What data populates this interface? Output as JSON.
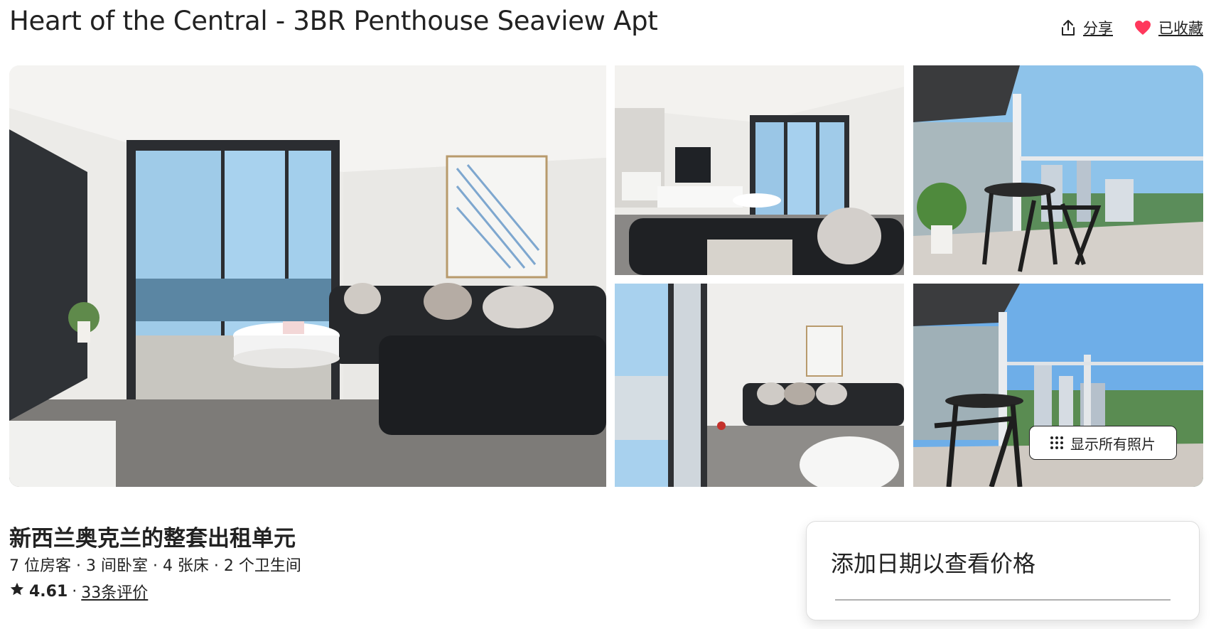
{
  "listing": {
    "title": "Heart of the Central - 3BR Penthouse Seaview Apt",
    "share_label": "分享",
    "save_label": "已收藏",
    "subtitle": "新西兰奥克兰的整套出租单元",
    "details": "7 位房客 · 3 间卧室 · 4 张床 · 2 个卫生间",
    "rating": "4.61",
    "rating_separator": "·",
    "reviews_label": "33条评价"
  },
  "gallery": {
    "show_all_label": "显示所有照片"
  },
  "booking": {
    "prompt": "添加日期以查看价格"
  },
  "colors": {
    "heart": "#ff385c",
    "text": "#222222",
    "border": "#dddddd"
  },
  "icons": [
    "share-icon",
    "heart-icon",
    "grid-dots-icon",
    "star-icon"
  ]
}
